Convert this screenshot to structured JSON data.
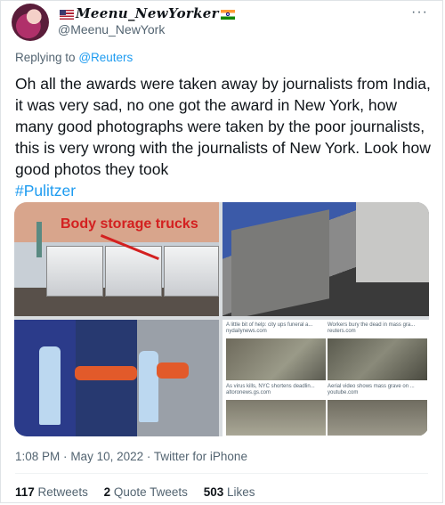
{
  "author": {
    "display_name": "Meenu_NewYorker",
    "handle": "@Meenu_NewYork",
    "flags": [
      "us-flag",
      "india-flag"
    ]
  },
  "more_label": "···",
  "reply": {
    "prefix": "Replying to",
    "to": "@Reuters"
  },
  "tweet": {
    "text": "Oh all the awards were taken away by journalists from India, it was very sad, no one got the award in New York, how many good photographs were taken by the poor journalists, this is very wrong with the journalists of New York. Look how good photos they took",
    "hashtag": "#Pulitzer"
  },
  "media": {
    "overlay_label": "Body storage trucks",
    "results": [
      {
        "caption": "A little bit of help: city ups funeral a...",
        "source": "nydailynews.com"
      },
      {
        "caption": "Workers bury the dead in mass gra...",
        "source": "reuters.com"
      },
      {
        "caption": "As virus kills, NYC shortens deadlin...",
        "source": "altoronews.gs.com"
      },
      {
        "caption": "Aerial video shows mass grave on ...",
        "source": "youtube.com"
      }
    ]
  },
  "meta": {
    "time": "1:08 PM",
    "date": "May 10, 2022",
    "client": "Twitter for iPhone",
    "separator": "·"
  },
  "stats": {
    "retweets_count": "117",
    "retweets_label": "Retweets",
    "quotes_count": "2",
    "quotes_label": "Quote Tweets",
    "likes_count": "503",
    "likes_label": "Likes"
  }
}
